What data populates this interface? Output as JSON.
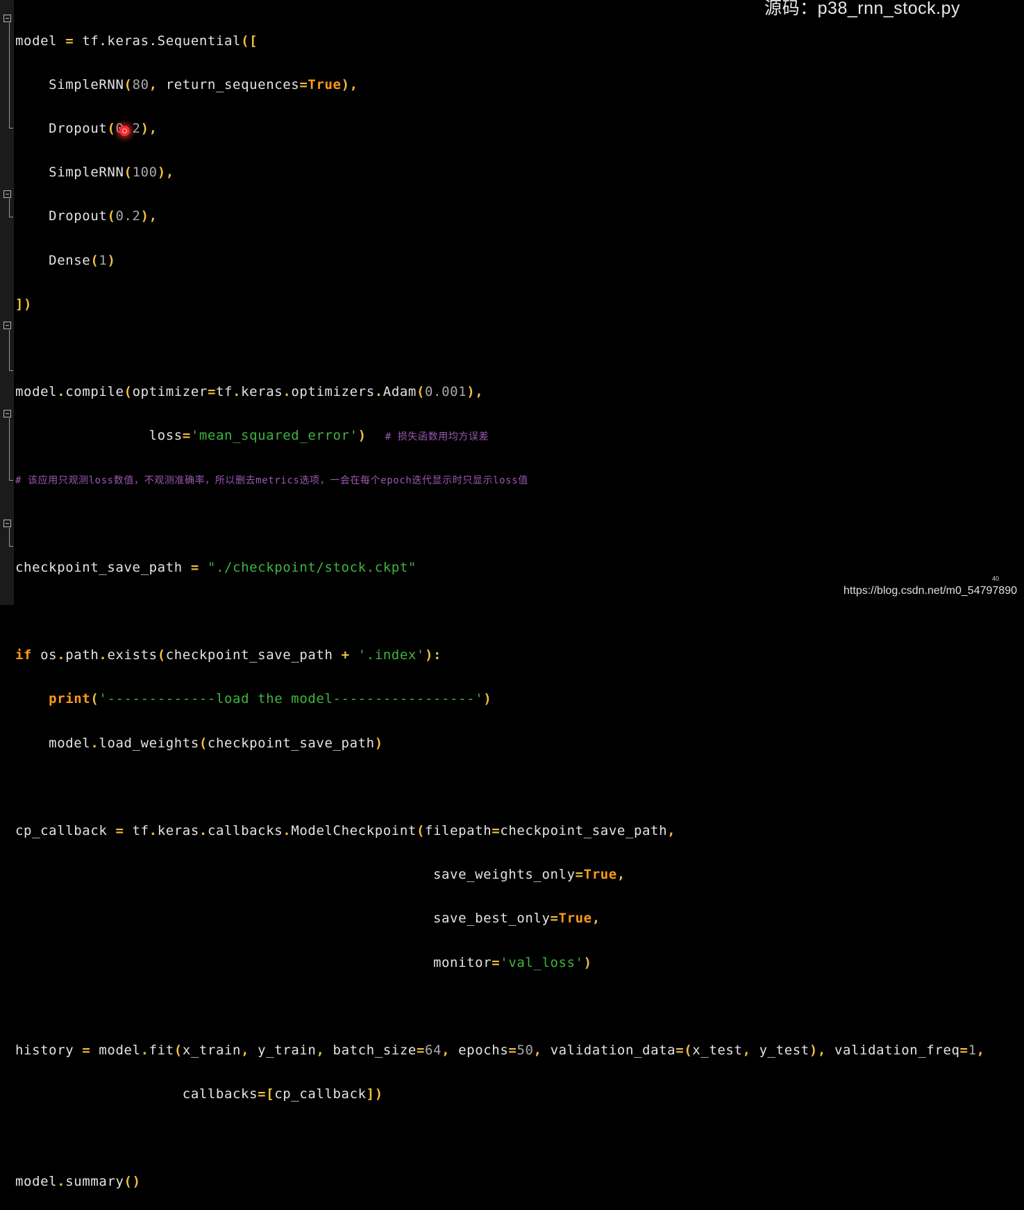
{
  "header": {
    "source_label": "源码：p38_rnn_stock.py"
  },
  "code": {
    "l01": {
      "a": "model ",
      "b": "=",
      "c": " tf.keras.Sequential",
      "d": "(["
    },
    "l02": {
      "a": "    SimpleRNN",
      "b": "(",
      "c": "80",
      "d": ",",
      "e": " return_sequences",
      "f": "=",
      "g": "True",
      "h": "),",
      "i": ""
    },
    "l03": {
      "a": "    Dropout",
      "b": "(",
      "c": "0.2",
      "d": "),",
      "e": ""
    },
    "l04": {
      "a": "    SimpleRNN",
      "b": "(",
      "c": "100",
      "d": "),",
      "e": ""
    },
    "l05": {
      "a": "    Dropout",
      "b": "(",
      "c": "0.2",
      "d": "),",
      "e": ""
    },
    "l06": {
      "a": "    Dense",
      "b": "(",
      "c": "1",
      "d": ")"
    },
    "l07": {
      "a": "])"
    },
    "l09": {
      "a": "model",
      "b": ".",
      "c": "compile",
      "d": "(",
      "e": "optimizer",
      "f": "=",
      "g": "tf",
      "h": ".",
      "i": "keras",
      "j": ".",
      "k": "optimizers",
      "l": ".",
      "m": "Adam",
      "n": "(",
      "o": "0.001",
      "p": "),",
      "q": ""
    },
    "l10": {
      "a": "                loss",
      "b": "=",
      "c": "'mean_squared_error'",
      "d": ")",
      "e": "   # 损失函数用均方误差"
    },
    "l11": {
      "a": "# 该应用只观测loss数值，不观测准确率，所以删去metrics选项，一会在每个epoch迭代显示时只显示loss值"
    },
    "l13": {
      "a": "checkpoint_save_path ",
      "b": "=",
      "c": " ",
      "d": "\"./checkpoint/stock.ckpt\""
    },
    "l15": {
      "a": "if",
      "b": " os",
      "c": ".",
      "d": "path",
      "e": ".",
      "f": "exists",
      "g": "(",
      "h": "checkpoint_save_path ",
      "i": "+",
      "j": " ",
      "k": "'.index'",
      "l": "):"
    },
    "l16": {
      "a": "    ",
      "b": "print",
      "c": "(",
      "d": "'-------------load the model-----------------'",
      "e": ")"
    },
    "l17": {
      "a": "    model",
      "b": ".",
      "c": "load_weights",
      "d": "(",
      "e": "checkpoint_save_path",
      "f": ")"
    },
    "l19": {
      "a": "cp_callback ",
      "b": "=",
      "c": " tf",
      "d": ".",
      "e": "keras",
      "f": ".",
      "g": "callbacks",
      "h": ".",
      "i": "ModelCheckpoint",
      "j": "(",
      "k": "filepath",
      "l": "=",
      "m": "checkpoint_save_path",
      "n": ","
    },
    "l20": {
      "a": "                                                  save_weights_only",
      "b": "=",
      "c": "True",
      "d": ","
    },
    "l21": {
      "a": "                                                  save_best_only",
      "b": "=",
      "c": "True",
      "d": ","
    },
    "l22": {
      "a": "                                                  monitor",
      "b": "=",
      "c": "'val_loss'",
      "d": ")"
    },
    "l24": {
      "a": "history ",
      "b": "=",
      "c": " model",
      "d": ".",
      "e": "fit",
      "f": "(",
      "g": "x_train",
      "h": ",",
      "i": " y_train",
      "j": ",",
      "k": " batch_size",
      "l": "=",
      "m": "64",
      "n": ",",
      "o": " epochs",
      "p": "=",
      "q": "50",
      "r": ",",
      "s": " validation_data",
      "t": "=(",
      "u": "x_test",
      "v": ",",
      "w": " y_test",
      "x": "),",
      "y": " validation_freq",
      "z": "=",
      "aa": "1",
      "bb": ","
    },
    "l25": {
      "a": "                    callbacks",
      "b": "=[",
      "c": "cp_callback",
      "d": "])"
    },
    "l27": {
      "a": "model",
      "b": ".",
      "c": "summary",
      "d": "()"
    }
  },
  "footer": {
    "page_number": "40",
    "watermark": "https://blog.csdn.net/m0_54797890"
  }
}
